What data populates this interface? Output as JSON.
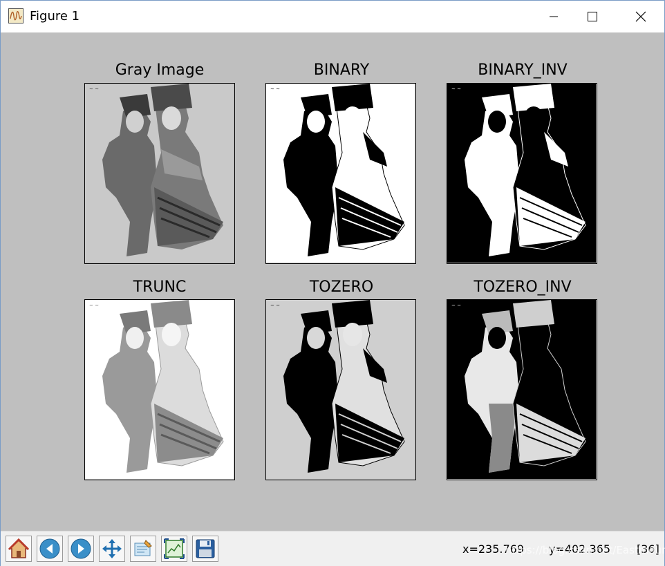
{
  "window": {
    "title": "Figure 1",
    "icon": "figure-wave-icon",
    "controls": [
      "minimize-icon",
      "maximize-icon",
      "close-icon"
    ]
  },
  "figure": {
    "background": "#bfbfbf",
    "subplots": [
      {
        "title": "Gray Image",
        "variant": "gray"
      },
      {
        "title": "BINARY",
        "variant": "binary"
      },
      {
        "title": "BINARY_INV",
        "variant": "binary_inv"
      },
      {
        "title": "TRUNC",
        "variant": "trunc"
      },
      {
        "title": "TOZERO",
        "variant": "tozero"
      },
      {
        "title": "TOZERO_INV",
        "variant": "tozero_inv"
      }
    ]
  },
  "toolbar": {
    "buttons": [
      {
        "name": "home-button",
        "icon": "home-icon"
      },
      {
        "name": "back-button",
        "icon": "arrow-left-icon"
      },
      {
        "name": "forward-button",
        "icon": "arrow-right-icon"
      },
      {
        "name": "pan-button",
        "icon": "move-arrows-icon"
      },
      {
        "name": "edit-subplots-button",
        "icon": "subplots-icon"
      },
      {
        "name": "zoom-button",
        "icon": "zoom-rect-icon"
      },
      {
        "name": "save-button",
        "icon": "floppy-disk-icon"
      }
    ],
    "x_readout": "x=235.769",
    "y_readout": "y=402.365",
    "value_readout": "[36]",
    "watermark": "https://blog.csdn.net/Eastmount"
  }
}
